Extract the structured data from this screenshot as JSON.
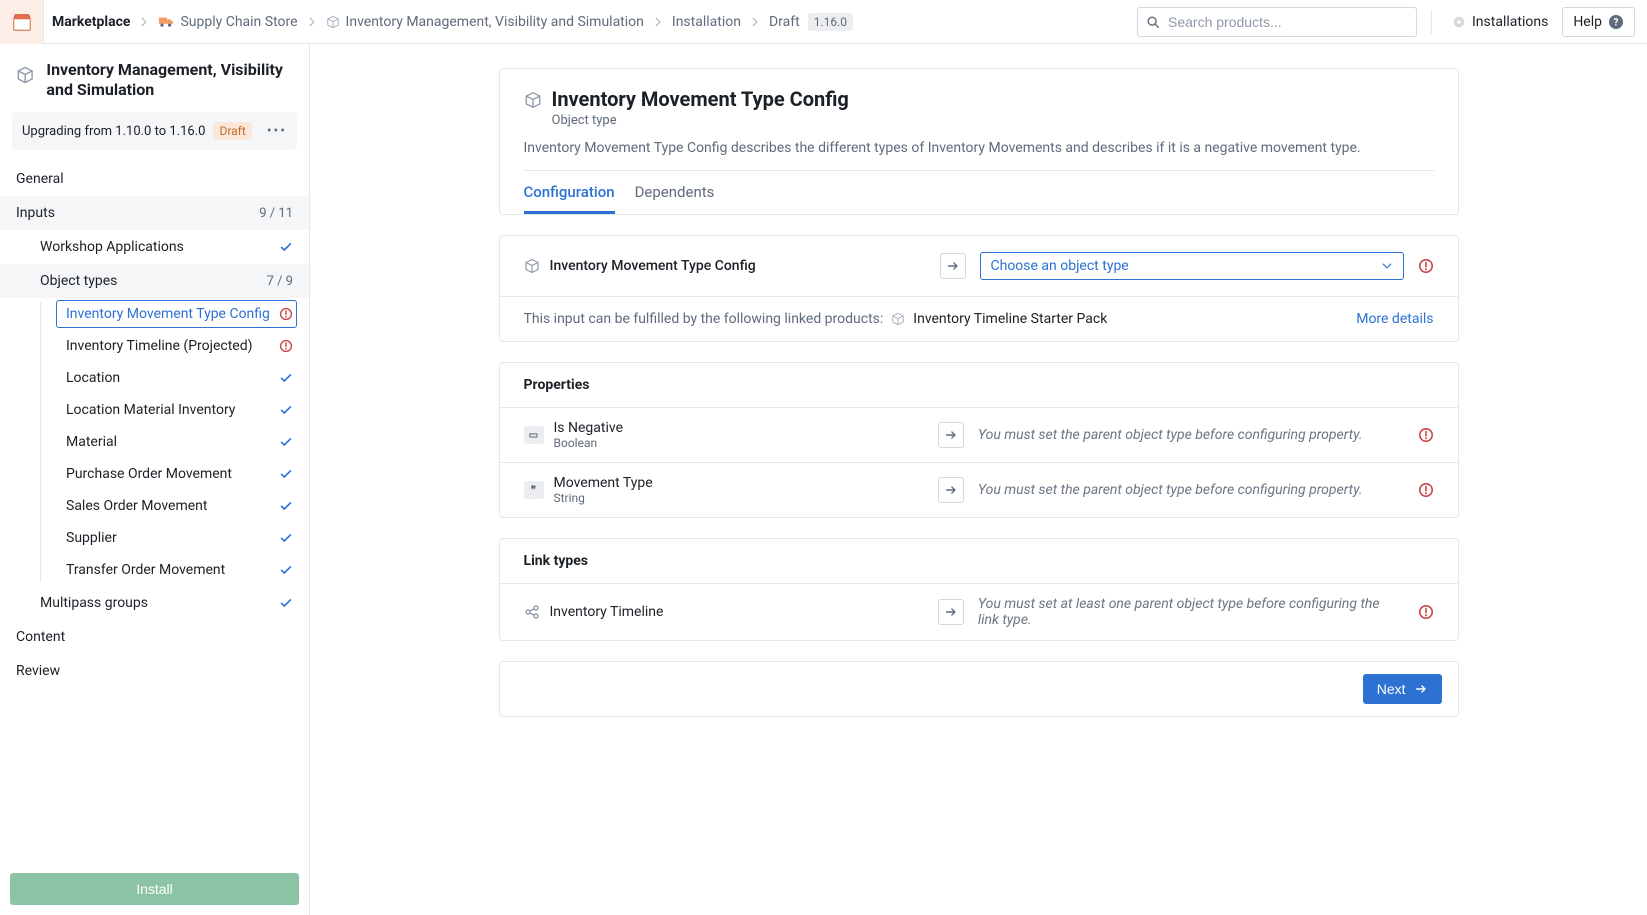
{
  "topbar": {
    "app": "Marketplace",
    "store": "Supply Chain Store",
    "product": "Inventory Management, Visibility and Simulation",
    "page": "Installation",
    "state": "Draft",
    "version": "1.16.0",
    "search_placeholder": "Search products...",
    "installations": "Installations",
    "help": "Help"
  },
  "sidebar": {
    "title": "Inventory Management, Visibility and Simulation",
    "upgrade_text": "Upgrading from 1.10.0 to 1.16.0",
    "upgrade_badge": "Draft",
    "sections": {
      "general": "General",
      "inputs": "Inputs",
      "inputs_count": "9 / 11",
      "workshop": "Workshop Applications",
      "object_types": "Object types",
      "object_types_count": "7 / 9",
      "multipass": "Multipass groups",
      "content": "Content",
      "review": "Review"
    },
    "objects": [
      {
        "label": "Inventory Movement Type Config",
        "status": "error",
        "selected": true
      },
      {
        "label": "Inventory Timeline (Projected)",
        "status": "error"
      },
      {
        "label": "Location",
        "status": "ok"
      },
      {
        "label": "Location Material Inventory",
        "status": "ok"
      },
      {
        "label": "Material",
        "status": "ok"
      },
      {
        "label": "Purchase Order Movement",
        "status": "ok"
      },
      {
        "label": "Sales Order Movement",
        "status": "ok"
      },
      {
        "label": "Supplier",
        "status": "ok"
      },
      {
        "label": "Transfer Order Movement",
        "status": "ok"
      }
    ],
    "install": "Install"
  },
  "main": {
    "title": "Inventory Movement Type Config",
    "subtitle": "Object type",
    "description": "Inventory Movement Type Config describes the different types of Inventory Movements and describes if it is a negative movement type.",
    "tabs": {
      "configuration": "Configuration",
      "dependents": "Dependents"
    },
    "config_label": "Inventory Movement Type Config",
    "select_placeholder": "Choose an object type",
    "linked_intro": "This input can be fulfilled by the following linked products:",
    "linked_product": "Inventory Timeline Starter Pack",
    "more_details": "More details",
    "properties_title": "Properties",
    "properties": [
      {
        "name": "Is Negative",
        "type": "Boolean",
        "msg": "You must set the parent object type before configuring property.",
        "icon": "bool"
      },
      {
        "name": "Movement Type",
        "type": "String",
        "msg": "You must set the parent object type before configuring property.",
        "icon": "string"
      }
    ],
    "link_types_title": "Link types",
    "link_types": [
      {
        "name": "Inventory Timeline",
        "msg": "You must set at least one parent object type before configuring the link type."
      }
    ],
    "next": "Next"
  }
}
